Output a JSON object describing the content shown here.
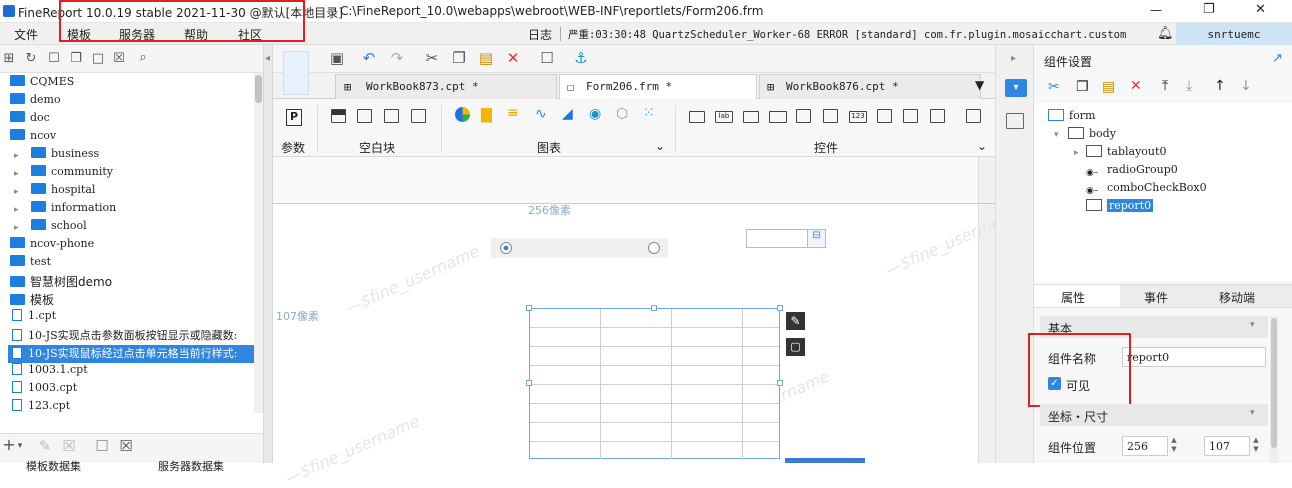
{
  "titlebar": {
    "app_title": "FineReport 10.0.19 stable 2021-11-30 @默认[本地目录]",
    "file_path": "C:\\FineReport_10.0\\webapps\\webroot\\WEB-INF\\reportlets/Form206.frm",
    "minimize": "—",
    "restore": "❐",
    "close": "✕"
  },
  "menubar": {
    "items": [
      "文件",
      "模板",
      "服务器",
      "帮助",
      "社区"
    ],
    "log_label": "日志",
    "log_text": "严重:03:30:48 QuartzScheduler_Worker-68 ERROR [standard] com.fr.plugin.mosaicchart.custom...",
    "user": "snrtuemc"
  },
  "tree": {
    "items": [
      {
        "label": "CQMES",
        "kind": "folder"
      },
      {
        "label": "demo",
        "kind": "folder"
      },
      {
        "label": "doc",
        "kind": "folder"
      },
      {
        "label": "ncov",
        "kind": "folder"
      },
      {
        "label": "business",
        "kind": "folder"
      },
      {
        "label": "community",
        "kind": "folder"
      },
      {
        "label": "hospital",
        "kind": "folder"
      },
      {
        "label": "information",
        "kind": "folder"
      },
      {
        "label": "school",
        "kind": "folder"
      },
      {
        "label": "ncov-phone",
        "kind": "folder"
      },
      {
        "label": "test",
        "kind": "folder"
      },
      {
        "label": "智慧树图demo",
        "kind": "folder"
      },
      {
        "label": "模板",
        "kind": "folder"
      },
      {
        "label": "1.cpt",
        "kind": "file"
      },
      {
        "label": "10-JS实现点击参数面板按钮显示或隐藏数:",
        "kind": "file"
      },
      {
        "label": "10-JS实现鼠标经过点击单元格当前行样式:",
        "kind": "file"
      },
      {
        "label": "1003.1.cpt",
        "kind": "file"
      },
      {
        "label": "1003.cpt",
        "kind": "file"
      },
      {
        "label": "123.cpt",
        "kind": "file"
      }
    ],
    "bottom_tabs": [
      "模板数据集",
      "服务器数据集"
    ]
  },
  "tabs": [
    {
      "label": "WorkBook873.cpt *"
    },
    {
      "label": "Form206.frm *"
    },
    {
      "label": "WorkBook876.cpt *"
    }
  ],
  "widgetbar": {
    "groups": [
      "参数",
      "空白块",
      "图表",
      "控件"
    ]
  },
  "canvas": {
    "ruler_top": "256像素",
    "ruler_left": "107像素",
    "watermark": "—$fine_username"
  },
  "rightpanel": {
    "title": "组件设置",
    "tree": [
      "form",
      "body",
      "tablayout0",
      "radioGroup0",
      "comboCheckBox0",
      "report0"
    ],
    "prop_tabs": [
      "属性",
      "事件",
      "移动端"
    ],
    "section_basic": "基本",
    "name_label": "组件名称",
    "name_value": "report0",
    "visible_label": "可见",
    "section_pos": "坐标・尺寸",
    "pos_label": "组件位置",
    "pos_x": "256",
    "pos_y": "107"
  }
}
